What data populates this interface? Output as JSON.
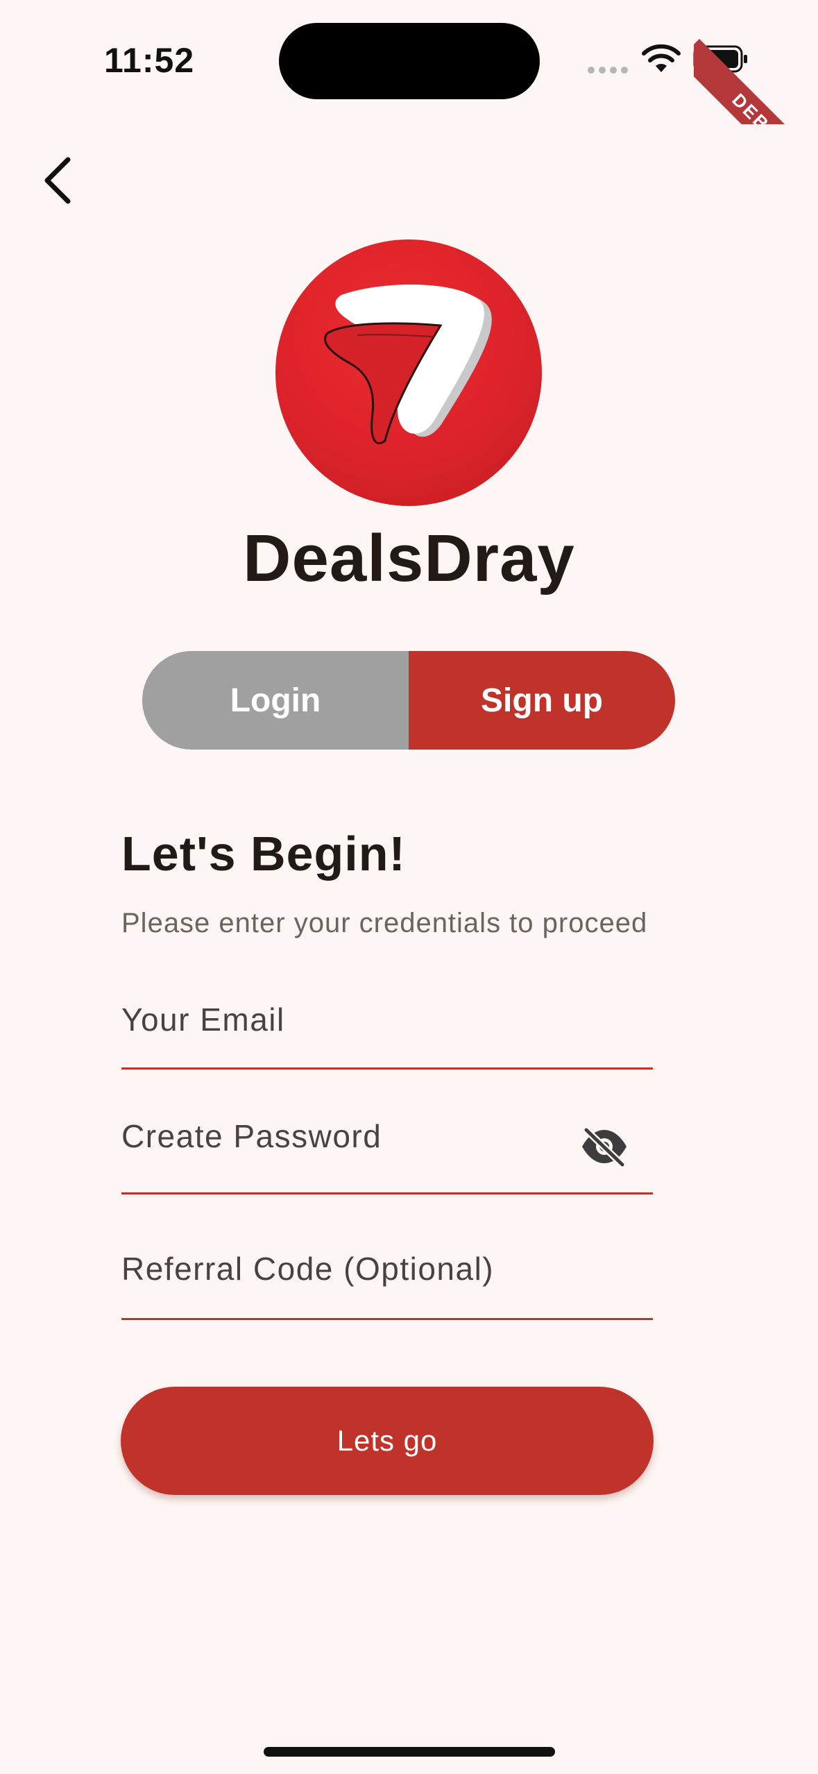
{
  "status_bar": {
    "time": "11:52",
    "debug_label": "DEBUG"
  },
  "brand": {
    "name": "DealsDray"
  },
  "segment": {
    "login_label": "Login",
    "signup_label": "Sign up",
    "selected": "Sign up"
  },
  "form": {
    "heading": "Let's Begin!",
    "subheading": "Please enter your credentials to proceed",
    "email_label": "Your Email",
    "password_label": "Create Password",
    "referral_label": "Referral Code (Optional)",
    "submit_label": "Lets go"
  },
  "icons": {
    "back": "chevron-left-icon",
    "visibility": "eye-off-icon"
  },
  "colors": {
    "accent": "#c0332b",
    "background": "#fdf6f4",
    "inactive_segment": "#a0a0a0",
    "logo_red": "#dc2329"
  }
}
